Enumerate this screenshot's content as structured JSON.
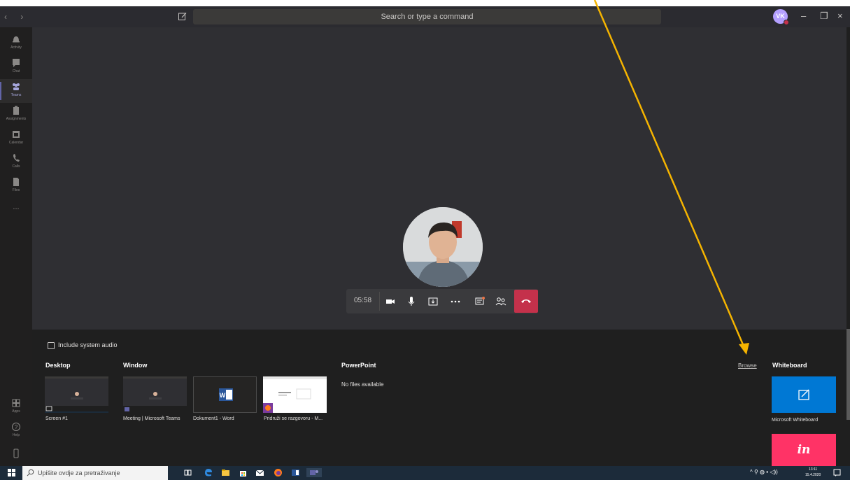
{
  "titlebar": {
    "search_placeholder": "Search or type a command",
    "user_initials": "VK",
    "window_controls": [
      "–",
      "❐",
      "×"
    ]
  },
  "rail": {
    "items": [
      {
        "label": "Activity",
        "icon": "bell-icon"
      },
      {
        "label": "Chat",
        "icon": "chat-icon"
      },
      {
        "label": "Teams",
        "icon": "teams-icon",
        "active": true
      },
      {
        "label": "Assignments",
        "icon": "assignments-icon"
      },
      {
        "label": "Calendar",
        "icon": "calendar-icon"
      },
      {
        "label": "Calls",
        "icon": "phone-icon"
      },
      {
        "label": "Files",
        "icon": "file-icon"
      },
      {
        "label": "...",
        "icon": "more-icon"
      }
    ],
    "bottom": [
      {
        "label": "Apps",
        "icon": "apps-icon"
      },
      {
        "label": "Help",
        "icon": "help-icon"
      }
    ]
  },
  "call": {
    "timer": "05:58",
    "controls": [
      "camera-icon",
      "mic-icon",
      "share-icon",
      "more-icon",
      "chat-icon",
      "participants-icon",
      "hangup-icon"
    ]
  },
  "share_tray": {
    "include_audio_label": "Include system audio",
    "sections": {
      "desktop": "Desktop",
      "window": "Window",
      "powerpoint": "PowerPoint",
      "browse": "Browse",
      "whiteboard": "Whiteboard"
    },
    "powerpoint_empty": "No files available",
    "thumbnails": [
      {
        "label": "Screen #1"
      },
      {
        "label": "Meeting | Microsoft Teams"
      },
      {
        "label": "Dokument1 - Word"
      },
      {
        "label": "Pridruži se razgovoru - M..."
      }
    ],
    "whiteboard_label": "Microsoft Whiteboard",
    "invision_logo": "in"
  },
  "taskbar": {
    "search_placeholder": "Upišite ovdje za pretraživanje",
    "time": "13:11",
    "date": "15.4.2020"
  },
  "colors": {
    "accent": "#6264a7",
    "hangup": "#c4314b",
    "whiteboard": "#0078d4",
    "invision": "#ff3366",
    "annotation_arrow": "#f5b400"
  }
}
